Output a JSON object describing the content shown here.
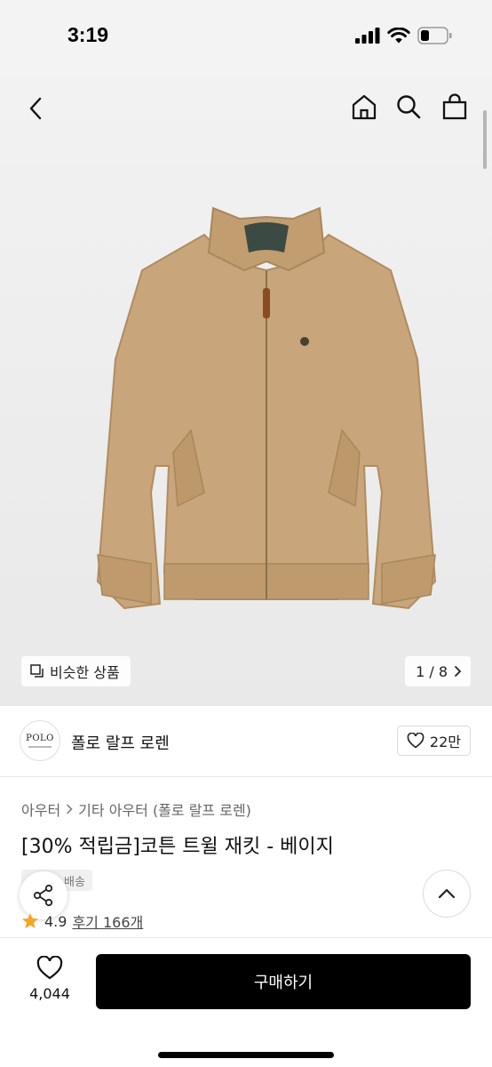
{
  "status_bar": {
    "time": "3:19"
  },
  "gallery": {
    "similar_label": "비슷한 상품",
    "counter": "1 / 8"
  },
  "brand": {
    "logo_text": "POLO",
    "name": "폴로 랄프 로렌",
    "likes": "22만"
  },
  "breadcrumb": {
    "items": [
      "아우터",
      "기타 아우터 (폴로 랄프 로렌)"
    ]
  },
  "product": {
    "title": "[30% 적립금]코튼 트윌 재킷 - 베이지",
    "badge": "배송",
    "rating": "4.9",
    "reviews": "후기 166개"
  },
  "bottom_bar": {
    "wish_count": "4,044",
    "buy_label": "구매하기"
  },
  "colors": {
    "accent": "#000000",
    "star": "#f5a623",
    "jacket": "#c8a57a"
  }
}
